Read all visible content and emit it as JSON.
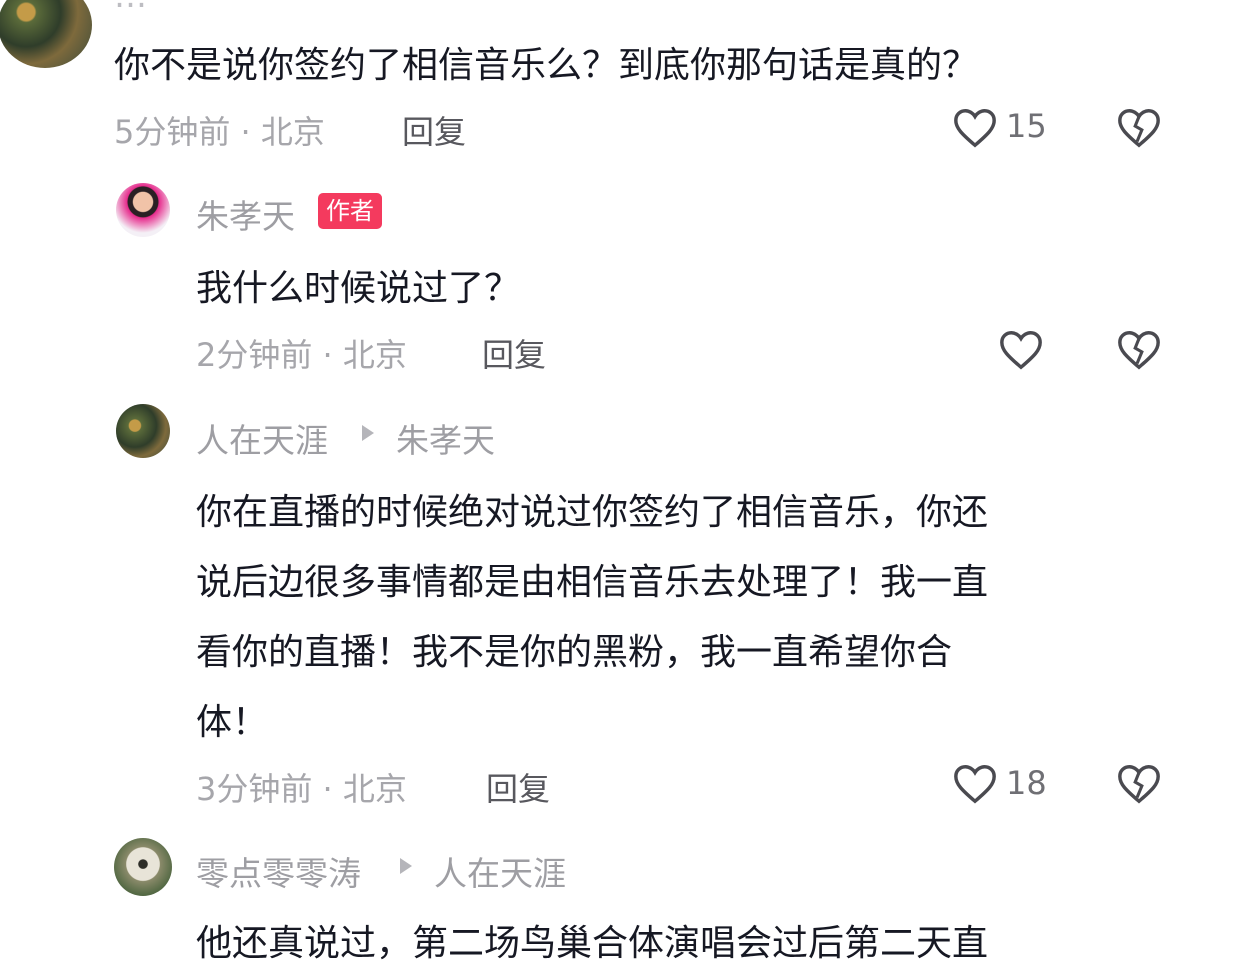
{
  "comments": [
    {
      "id": "c1",
      "text": "你不是说你签约了相信音乐么？到底你那句话是真的？",
      "time": "5分钟前",
      "location": "北京",
      "reply_label": "回复",
      "likes": "15"
    },
    {
      "id": "c2",
      "author": "朱孝天",
      "badge": "作者",
      "text": "我什么时候说过了？",
      "time": "2分钟前",
      "location": "北京",
      "reply_label": "回复"
    },
    {
      "id": "c3",
      "author": "人在天涯",
      "reply_to": "朱孝天",
      "lines": [
        "你在直播的时候绝对说过你签约了相信音乐，你还",
        "说后边很多事情都是由相信音乐去处理了！我一直",
        "看你的直播！我不是你的黑粉，我一直希望你合",
        "体！"
      ],
      "time": "3分钟前",
      "location": "北京",
      "reply_label": "回复",
      "likes": "18"
    },
    {
      "id": "c4",
      "author": "零点零零涛",
      "reply_to": "人在天涯",
      "text": "他还真说过，第二场鸟巢合体演唱会过后第二天直"
    }
  ],
  "separator": " · ",
  "icons": {
    "like": "heart-outline-icon",
    "dislike": "broken-heart-icon",
    "reply_arrow": "triangle-right-icon"
  },
  "colors": {
    "author_badge": "#f43a5e",
    "text": "#161823",
    "meta": "#a6a6ab"
  }
}
